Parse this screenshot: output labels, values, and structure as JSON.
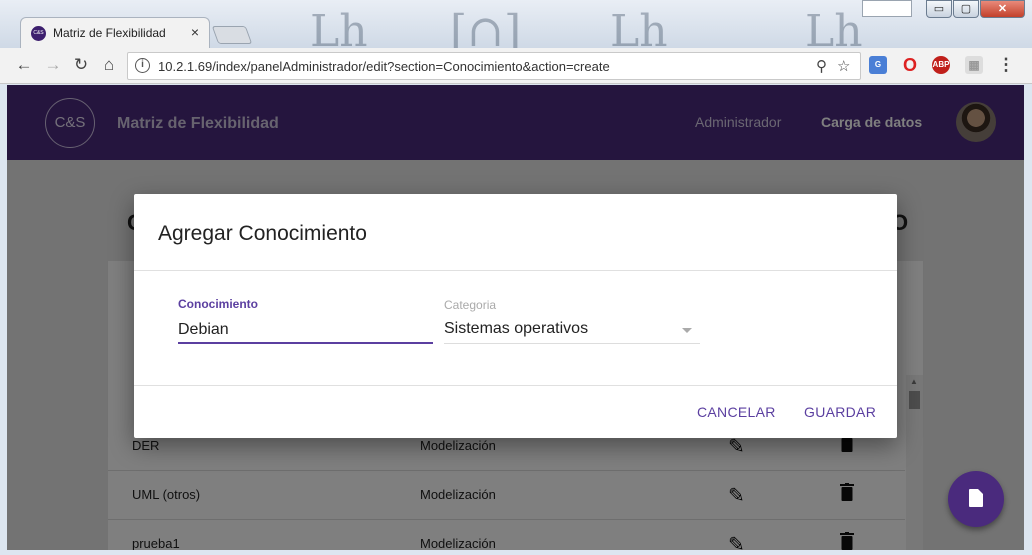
{
  "browser": {
    "tab_title": "Matriz de Flexibilidad",
    "tab_close": "×",
    "url": "10.2.1.69/index/panelAdministrador/edit?section=Conocimiento&action=create",
    "window_buttons": {
      "minimize": "▭",
      "maximize": "▢",
      "close": "✕"
    }
  },
  "app": {
    "logo_text": "C&S",
    "title": "Matriz de Flexibilidad",
    "nav": {
      "admin": "Administrador",
      "carga": "Carga de datos"
    }
  },
  "background_list": {
    "rows": [
      {
        "name": "DER",
        "category": "Modelización"
      },
      {
        "name": "UML (otros)",
        "category": "Modelización"
      },
      {
        "name": "prueba1",
        "category": "Modelización"
      }
    ],
    "partial_heading_left": "C",
    "partial_heading_right": "O"
  },
  "dialog": {
    "title": "Agregar Conocimiento",
    "field_conocimiento": {
      "label": "Conocimiento",
      "value": "Debian"
    },
    "field_categoria": {
      "label": "Categoria",
      "value": "Sistemas operativos"
    },
    "cancel_label": "CANCELAR",
    "save_label": "GUARDAR"
  },
  "icons": {
    "back": "back-arrow-icon",
    "forward": "forward-arrow-icon",
    "reload": "reload-icon",
    "home": "home-icon",
    "info": "info-icon",
    "key": "key-icon",
    "star": "star-icon",
    "menu": "kebab-menu-icon",
    "edit": "pencil-icon",
    "delete": "trash-icon",
    "fab": "document-icon"
  },
  "colors": {
    "primary": "#4a2a7d",
    "accent": "#5b3fa0"
  }
}
